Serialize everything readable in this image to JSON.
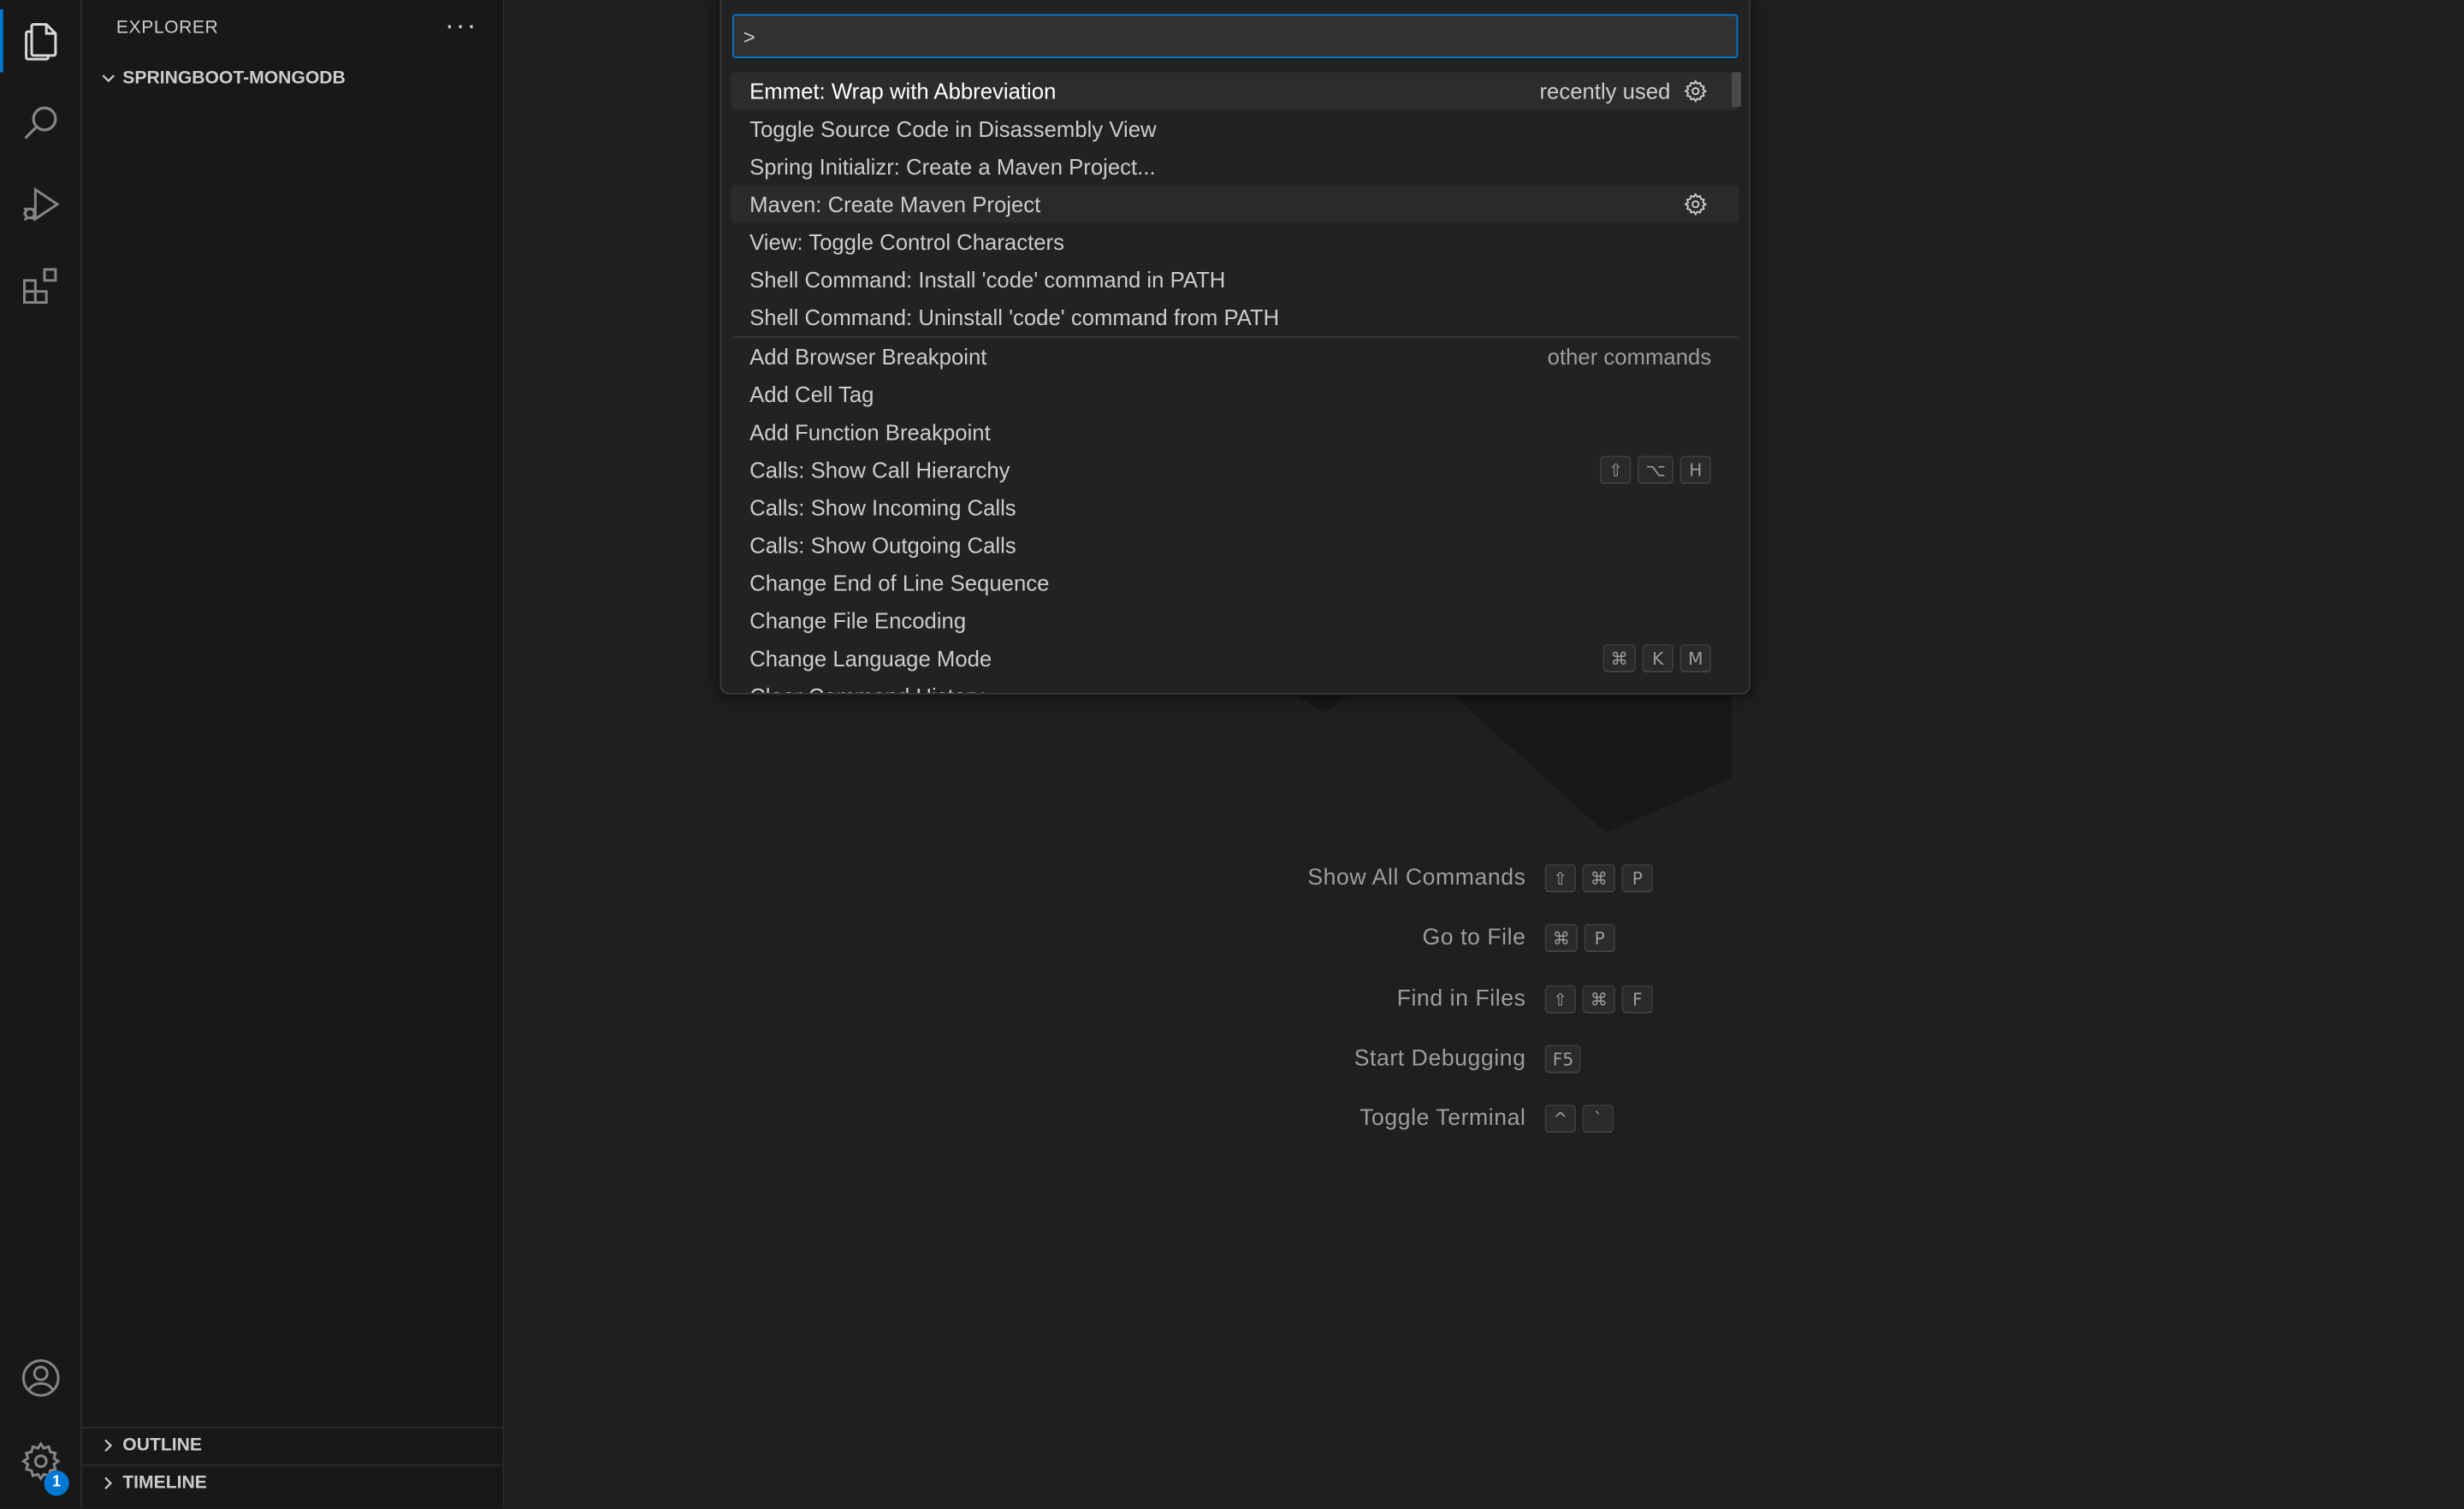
{
  "colors": {
    "accent": "#0078d4",
    "background": "#1f1f1f",
    "sidebar": "#181818"
  },
  "activity_bar": {
    "items": [
      {
        "icon": "files-icon",
        "active": true
      },
      {
        "icon": "search-icon"
      },
      {
        "icon": "run-debug-icon"
      },
      {
        "icon": "extensions-icon"
      }
    ],
    "bottom": [
      {
        "icon": "account-icon"
      },
      {
        "icon": "gear-icon",
        "badge": "1"
      }
    ]
  },
  "sidebar": {
    "title": "EXPLORER",
    "more": "···",
    "folder": "SPRINGBOOT-MONGODB",
    "sections": [
      "OUTLINE",
      "TIMELINE"
    ]
  },
  "quick_input": {
    "value": ">",
    "items": [
      {
        "label": "Emmet: Wrap with Abbreviation",
        "desc": "recently used",
        "gear": true,
        "selected": true
      },
      {
        "label": "Toggle Source Code in Disassembly View"
      },
      {
        "label": "Spring Initializr: Create a Maven Project..."
      },
      {
        "label": "Maven: Create Maven Project",
        "gear": true,
        "hover": true
      },
      {
        "label": "View: Toggle Control Characters"
      },
      {
        "label": "Shell Command: Install 'code' command in PATH"
      },
      {
        "label": "Shell Command: Uninstall 'code' command from PATH"
      },
      {
        "label": "Add Browser Breakpoint",
        "desc": "other commands",
        "separator": true
      },
      {
        "label": "Add Cell Tag"
      },
      {
        "label": "Add Function Breakpoint"
      },
      {
        "label": "Calls: Show Call Hierarchy",
        "keys": [
          "⇧",
          "⌥",
          "H"
        ]
      },
      {
        "label": "Calls: Show Incoming Calls"
      },
      {
        "label": "Calls: Show Outgoing Calls"
      },
      {
        "label": "Change End of Line Sequence"
      },
      {
        "label": "Change File Encoding"
      },
      {
        "label": "Change Language Mode",
        "keys": [
          "⌘",
          "K",
          "M"
        ]
      },
      {
        "label": "Clear Command History"
      }
    ]
  },
  "shortcuts": [
    {
      "label": "Show All Commands",
      "keys": [
        "⇧",
        "⌘",
        "P"
      ]
    },
    {
      "label": "Go to File",
      "keys": [
        "⌘",
        "P"
      ]
    },
    {
      "label": "Find in Files",
      "keys": [
        "⇧",
        "⌘",
        "F"
      ]
    },
    {
      "label": "Start Debugging",
      "keys": [
        "F5"
      ]
    },
    {
      "label": "Toggle Terminal",
      "keys": [
        "^",
        "`"
      ]
    }
  ]
}
